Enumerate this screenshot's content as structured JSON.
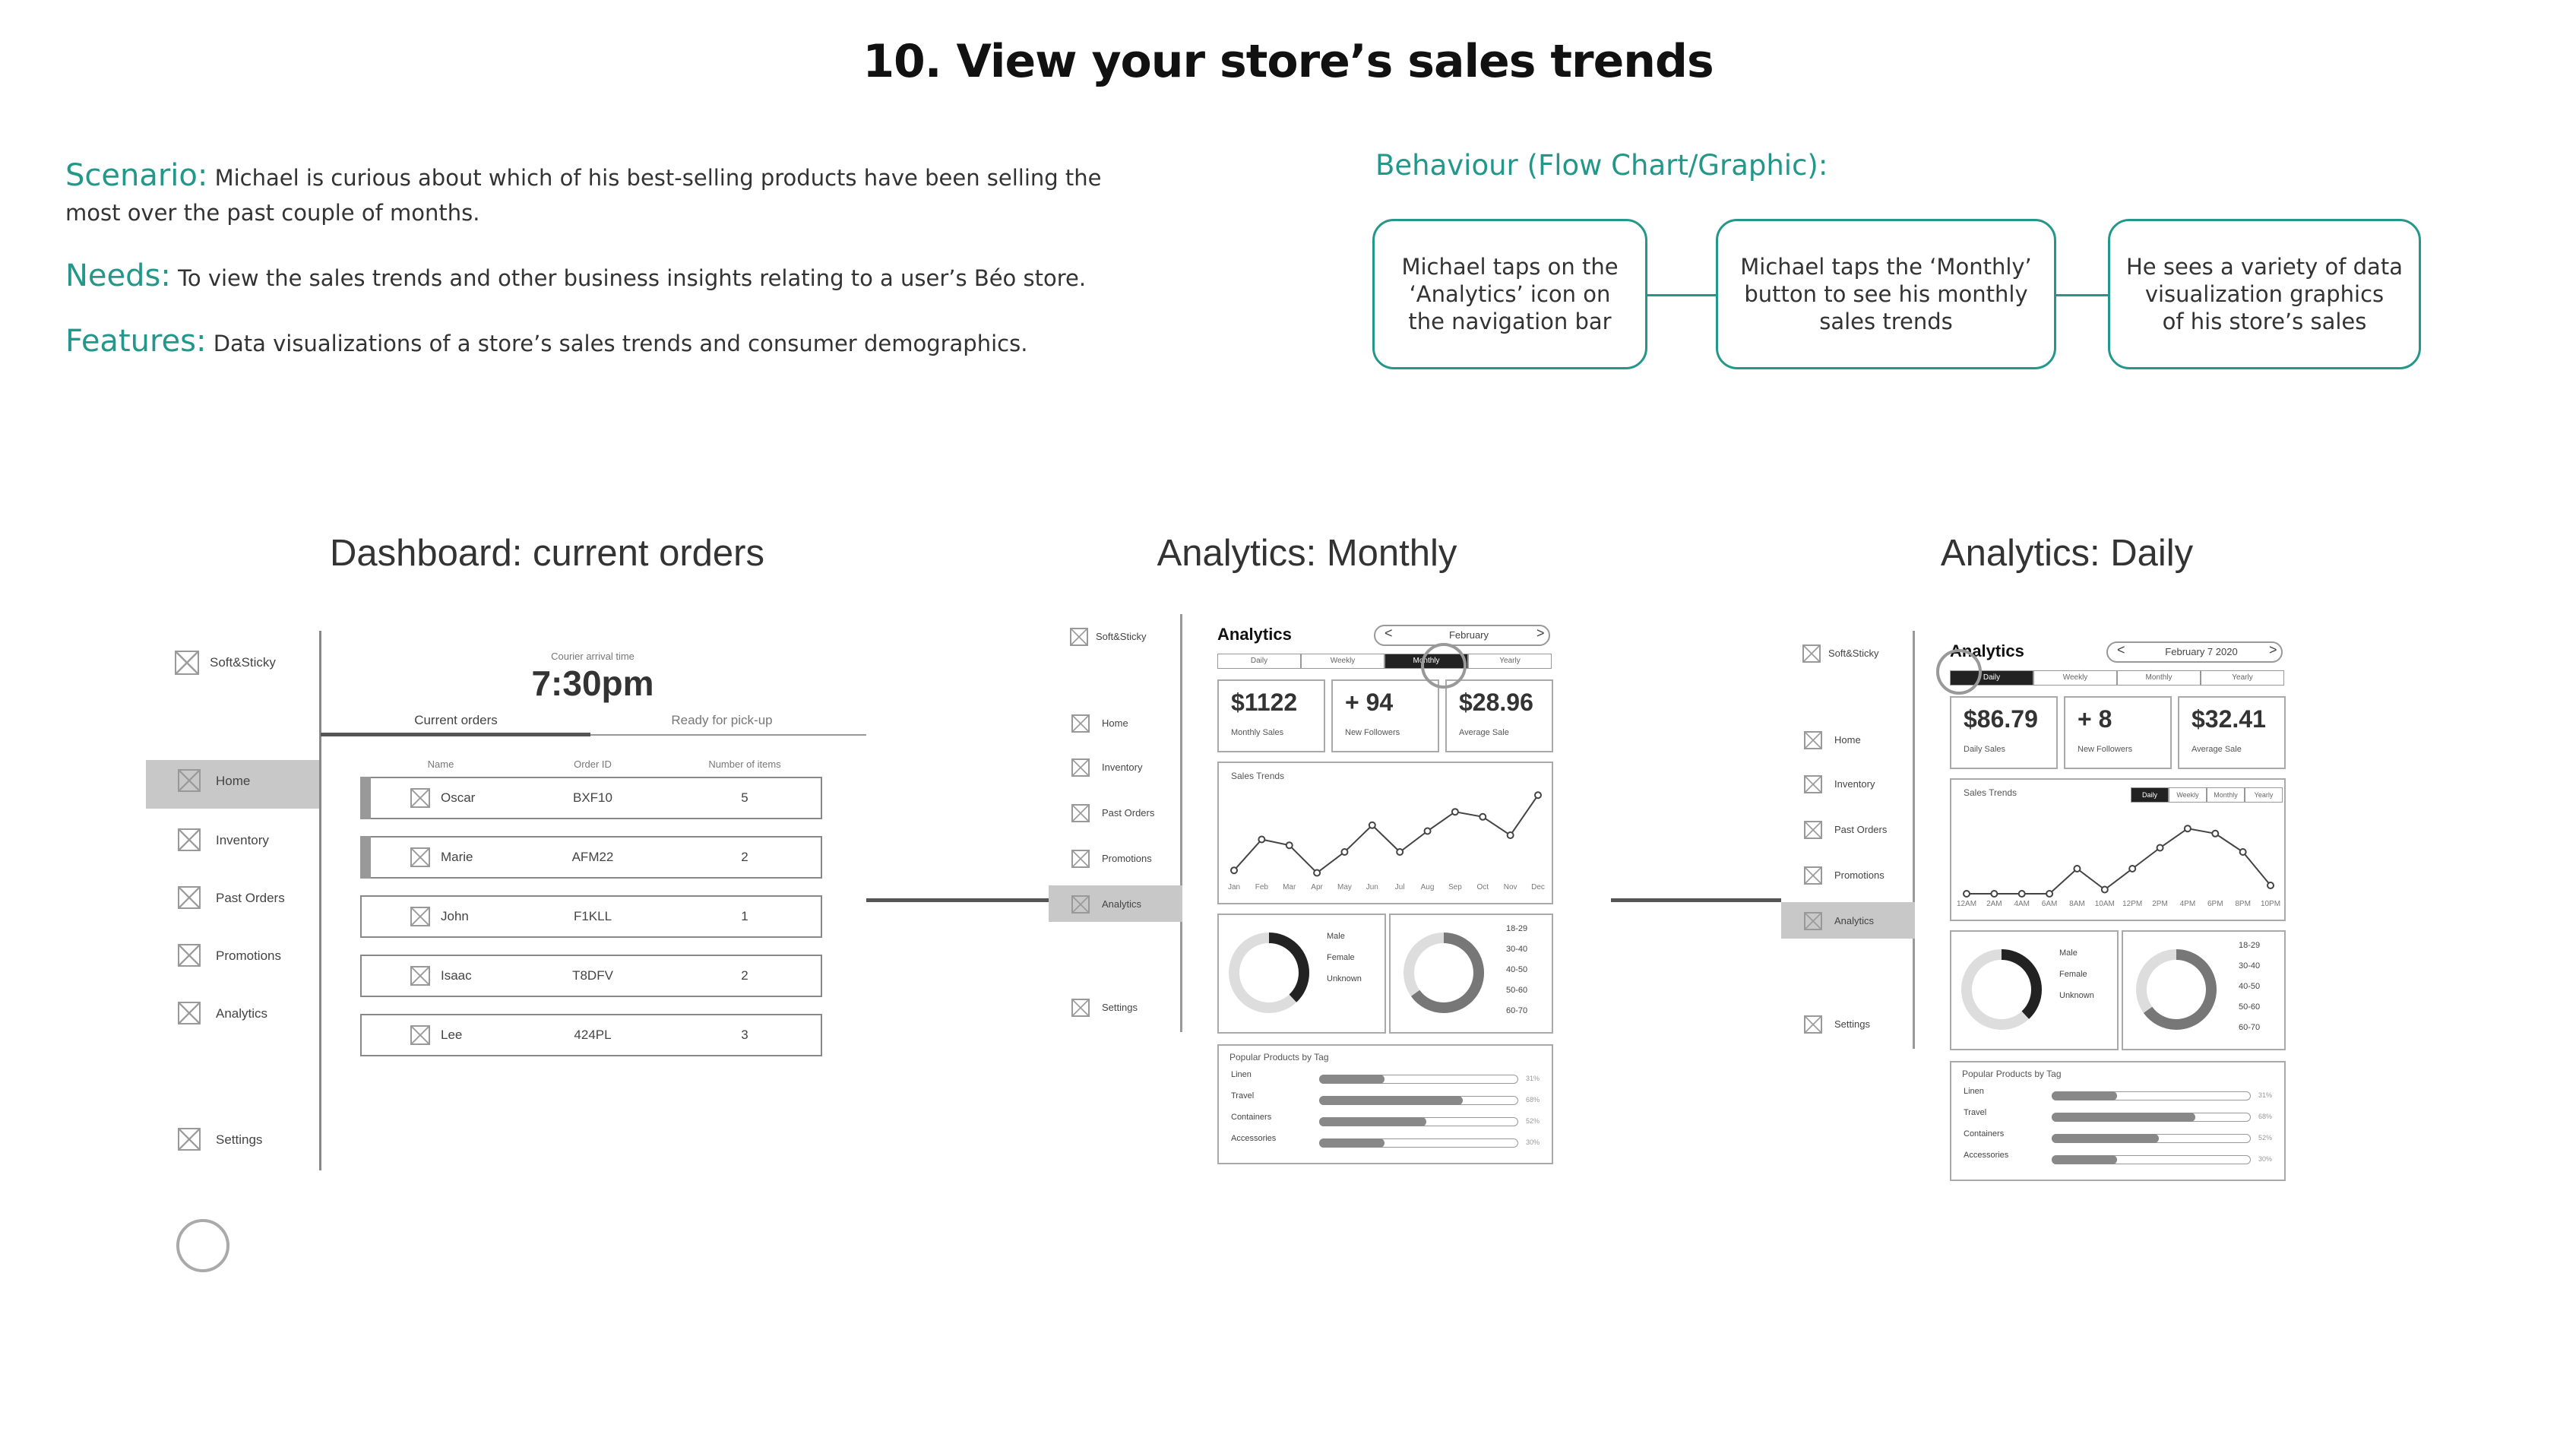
{
  "title": "10. View your store’s sales trends",
  "scenario": {
    "label": "Scenario:",
    "line1": "Michael is curious about which of his best-selling products have been selling the",
    "line2": "most over the past couple of months."
  },
  "needs": {
    "label": "Needs:",
    "text": "To view the sales trends and other business insights relating to a user’s Béo store."
  },
  "features": {
    "label": "Features:",
    "text": "Data visualizations of a store’s sales trends and consumer demographics."
  },
  "behaviour": {
    "label": "Behaviour (Flow Chart/Graphic):",
    "steps": [
      {
        "l1": "Michael taps on the",
        "l2": "‘Analytics’ icon on",
        "l3": "the navigation bar"
      },
      {
        "l1": "Michael taps the ‘Monthly’",
        "l2": "button to see his monthly",
        "l3": "sales trends"
      },
      {
        "l1": "He sees a variety of data",
        "l2": "visualization graphics",
        "l3": "of his store’s sales"
      }
    ]
  },
  "colors": {
    "accent": "#23978a",
    "selected_nav": "#c8c8c8",
    "dark_tab": "#222222"
  },
  "screens": {
    "dashboard": {
      "title": "Dashboard: current orders",
      "brand": "Soft&Sticky",
      "courier_label": "Courier arrival time",
      "courier_time": "7:30pm",
      "tabs": [
        "Current orders",
        "Ready for pick-up"
      ],
      "columns": [
        "Name",
        "Order ID",
        "Number of items"
      ],
      "orders": [
        {
          "name": "Oscar",
          "id": "BXF10",
          "items": "5"
        },
        {
          "name": "Marie",
          "id": "AFM22",
          "items": "2"
        },
        {
          "name": "John",
          "id": "F1KLL",
          "items": "1"
        },
        {
          "name": "Isaac",
          "id": "T8DFV",
          "items": "2"
        },
        {
          "name": "Lee",
          "id": "424PL",
          "items": "3"
        }
      ],
      "nav": [
        "Home",
        "Inventory",
        "Past Orders",
        "Promotions",
        "Analytics"
      ],
      "settings": "Settings",
      "selected_nav": "Home"
    },
    "monthly": {
      "title": "Analytics: Monthly",
      "brand": "Soft&Sticky",
      "heading": "Analytics",
      "date": "February",
      "prev": "<",
      "next": ">",
      "periods": [
        "Daily",
        "Weekly",
        "Monthly",
        "Yearly"
      ],
      "selected_period": "Monthly",
      "stats": [
        {
          "value": "$1122",
          "label": "Monthly Sales"
        },
        {
          "value": "+ 94",
          "label": "New Followers"
        },
        {
          "value": "$28.96",
          "label": "Average Sale"
        }
      ],
      "trends_label": "Sales Trends",
      "x_labels": [
        "Jan",
        "Feb",
        "Mar",
        "Apr",
        "May",
        "Jun",
        "Jul",
        "Aug",
        "Sep",
        "Oct",
        "Nov",
        "Dec"
      ],
      "gender": [
        "Male",
        "Female",
        "Unknown"
      ],
      "ages": [
        "18-29",
        "30-40",
        "40-50",
        "50-60",
        "60-70"
      ],
      "popular_label": "Popular Products by Tag",
      "products": [
        {
          "name": "Linen",
          "pct": "31%",
          "level": 0.33
        },
        {
          "name": "Travel",
          "pct": "68%",
          "level": 0.72
        },
        {
          "name": "Containers",
          "pct": "52%",
          "level": 0.54
        },
        {
          "name": "Accessories",
          "pct": "30%",
          "level": 0.33
        }
      ],
      "nav": [
        "Home",
        "Inventory",
        "Past Orders",
        "Promotions",
        "Analytics"
      ],
      "settings": "Settings"
    },
    "daily": {
      "title": "Analytics: Daily",
      "brand": "Soft&Sticky",
      "heading": "Analytics",
      "date": "February 7 2020",
      "prev": "<",
      "next": ">",
      "periods": [
        "Daily",
        "Weekly",
        "Monthly",
        "Yearly"
      ],
      "selected_period": "Daily",
      "stats": [
        {
          "value": "$86.79",
          "label": "Daily Sales"
        },
        {
          "value": "+ 8",
          "label": "New Followers"
        },
        {
          "value": "$32.41",
          "label": "Average Sale"
        }
      ],
      "trends_label": "Sales Trends",
      "x_labels": [
        "12AM",
        "2AM",
        "4AM",
        "6AM",
        "8AM",
        "10AM",
        "12PM",
        "2PM",
        "4PM",
        "6PM",
        "8PM",
        "10PM"
      ],
      "gender": [
        "Male",
        "Female",
        "Unknown"
      ],
      "ages": [
        "18-29",
        "30-40",
        "40-50",
        "50-60",
        "60-70"
      ],
      "popular_label": "Popular Products by Tag",
      "products": [
        {
          "name": "Linen",
          "pct": "31%",
          "level": 0.33
        },
        {
          "name": "Travel",
          "pct": "68%",
          "level": 0.72
        },
        {
          "name": "Containers",
          "pct": "52%",
          "level": 0.54
        },
        {
          "name": "Accessories",
          "pct": "30%",
          "level": 0.33
        }
      ],
      "nav": [
        "Home",
        "Inventory",
        "Past Orders",
        "Promotions",
        "Analytics"
      ],
      "settings": "Settings"
    }
  }
}
